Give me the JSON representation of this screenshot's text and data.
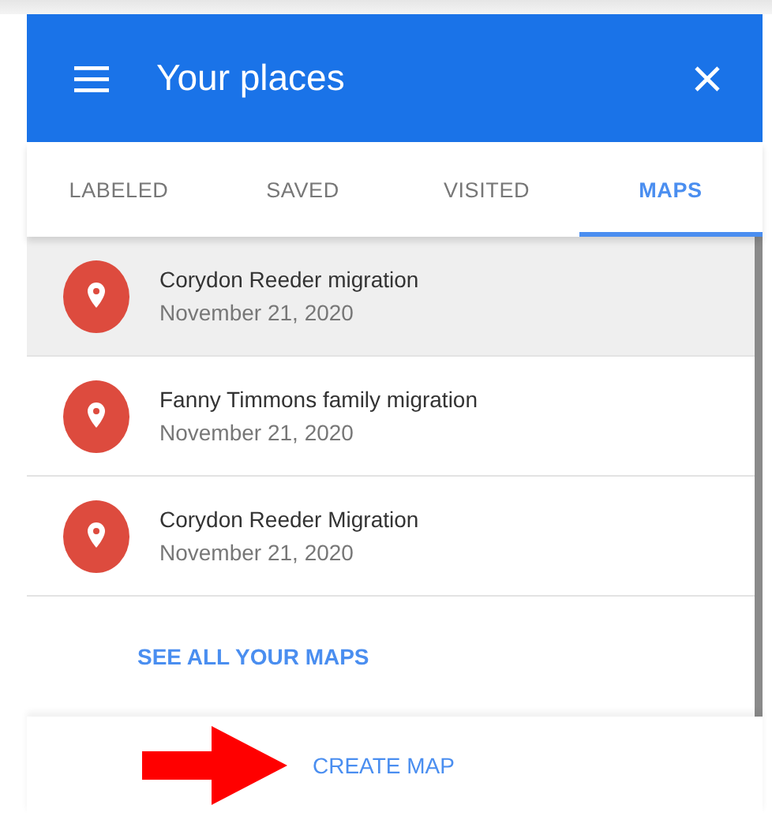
{
  "header": {
    "title": "Your places"
  },
  "tabs": [
    {
      "label": "LABELED",
      "selected": false
    },
    {
      "label": "SAVED",
      "selected": false
    },
    {
      "label": "VISITED",
      "selected": false
    },
    {
      "label": "MAPS",
      "selected": true
    }
  ],
  "maps": [
    {
      "name": "Corydon Reeder migration",
      "date": "November 21, 2020",
      "selected": true
    },
    {
      "name": "Fanny Timmons family migration",
      "date": "November 21, 2020",
      "selected": false
    },
    {
      "name": "Corydon Reeder Migration",
      "date": "November 21, 2020",
      "selected": false
    }
  ],
  "see_all_link": "SEE ALL YOUR MAPS",
  "create_button": "CREATE MAP"
}
